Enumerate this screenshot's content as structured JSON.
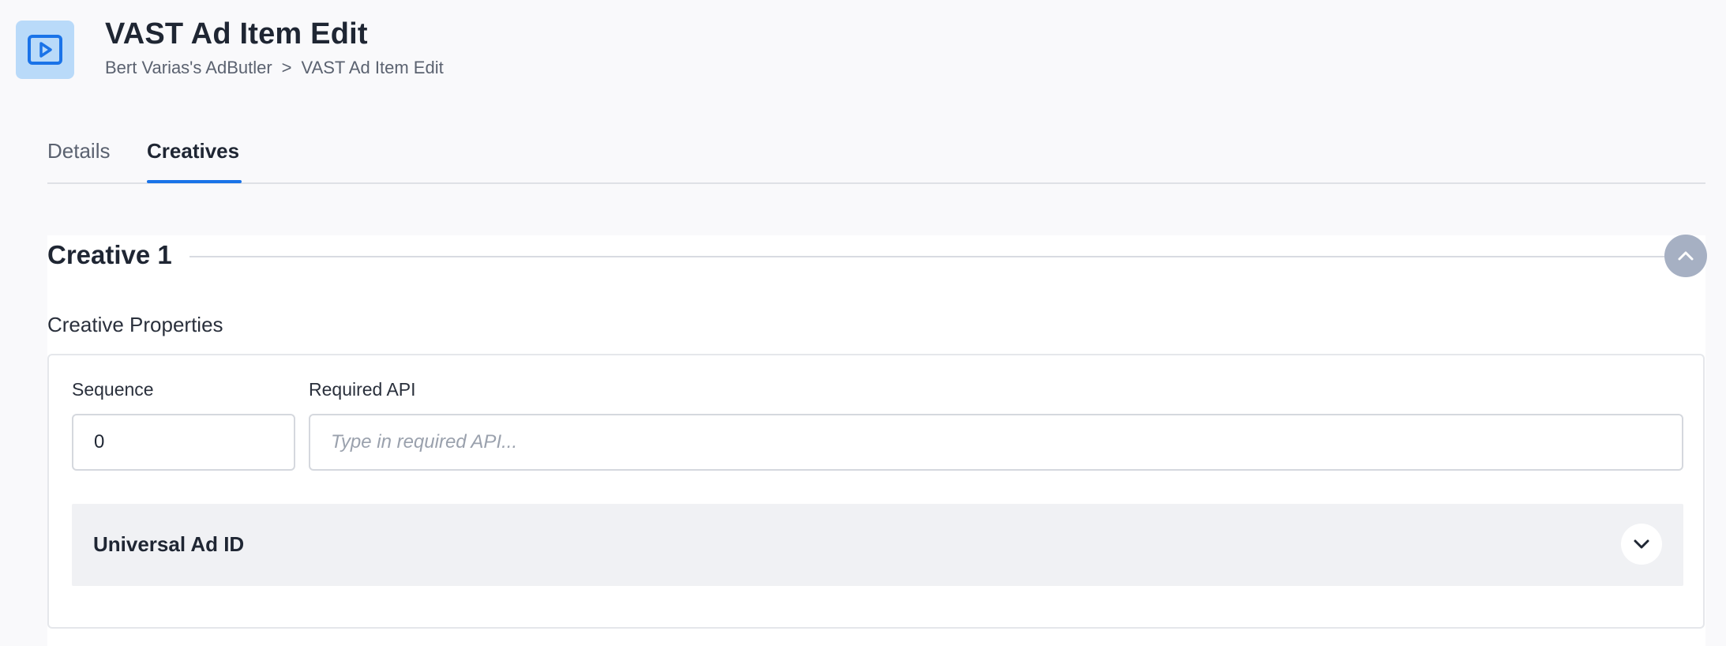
{
  "header": {
    "icon": "play-icon",
    "title": "VAST Ad Item Edit",
    "breadcrumb": {
      "parent": "Bert Varias's AdButler",
      "separator": ">",
      "current": "VAST Ad Item Edit"
    }
  },
  "tabs": [
    {
      "label": "Details",
      "active": false
    },
    {
      "label": "Creatives",
      "active": true
    }
  ],
  "creative": {
    "title": "Creative 1",
    "properties_heading": "Creative Properties",
    "sequence": {
      "label": "Sequence",
      "value": "0"
    },
    "required_api": {
      "label": "Required API",
      "value": "",
      "placeholder": "Type in required API..."
    },
    "universal_ad_id": {
      "label": "Universal Ad ID",
      "expanded": false
    }
  },
  "colors": {
    "accent": "#1a73e8",
    "icon_bg": "#b9daf9",
    "collapse_button": "#a6b0c3"
  }
}
